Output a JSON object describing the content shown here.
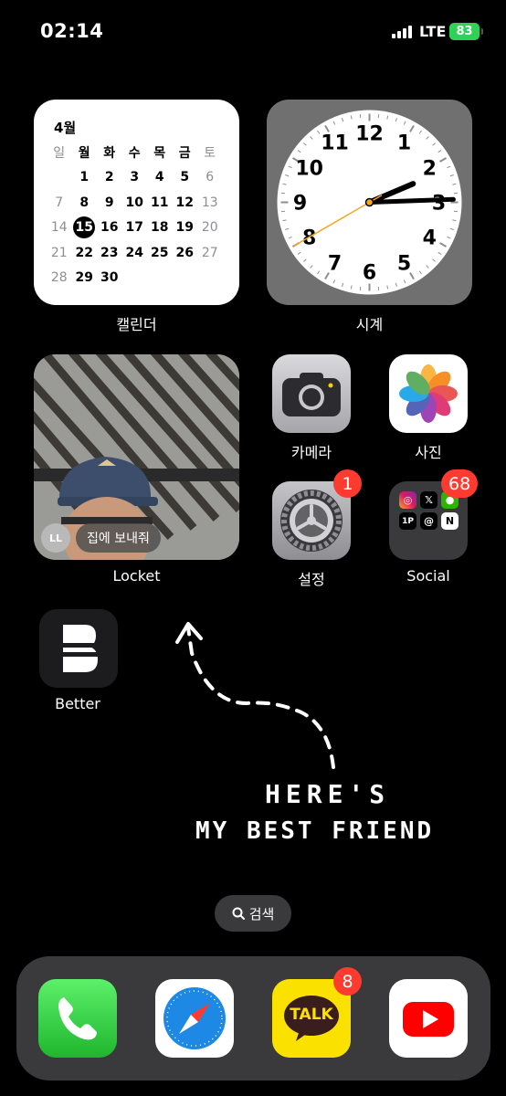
{
  "status_bar": {
    "time": "02:14",
    "network": "LTE",
    "battery": "83"
  },
  "calendar": {
    "month": "4월",
    "weekdays": [
      "일",
      "월",
      "화",
      "수",
      "목",
      "금",
      "토"
    ],
    "weeks": [
      [
        "",
        "1",
        "2",
        "3",
        "4",
        "5",
        "6"
      ],
      [
        "7",
        "8",
        "9",
        "10",
        "11",
        "12",
        "13"
      ],
      [
        "14",
        "15",
        "16",
        "17",
        "18",
        "19",
        "20"
      ],
      [
        "21",
        "22",
        "23",
        "24",
        "25",
        "26",
        "27"
      ],
      [
        "28",
        "29",
        "30",
        "",
        "",
        "",
        ""
      ]
    ],
    "today": "15",
    "label": "캘린더"
  },
  "clock": {
    "label": "시계",
    "numbers": [
      "12",
      "1",
      "2",
      "3",
      "4",
      "5",
      "6",
      "7",
      "8",
      "9",
      "10",
      "11"
    ],
    "hour": 2,
    "minute": 14,
    "second": 40
  },
  "locket": {
    "initials": "LL",
    "message": "집에 보내줘",
    "label": "Locket"
  },
  "apps": {
    "camera": {
      "label": "카메라"
    },
    "photos": {
      "label": "사진"
    },
    "settings": {
      "label": "설정",
      "badge": "1"
    },
    "social": {
      "label": "Social",
      "badge": "68"
    },
    "better": {
      "label": "Better"
    }
  },
  "handwriting": {
    "line1": "HERE'S",
    "line2": "MY BEST FRIEND"
  },
  "search": {
    "label": "검색"
  },
  "dock": {
    "kakao_text": "TALK",
    "kakao_badge": "8"
  },
  "colors": {
    "badge": "#ff3b30",
    "battery": "#30d158",
    "kakao": "#fae100",
    "youtube": "#ff0000",
    "second_hand": "#f5a623"
  }
}
